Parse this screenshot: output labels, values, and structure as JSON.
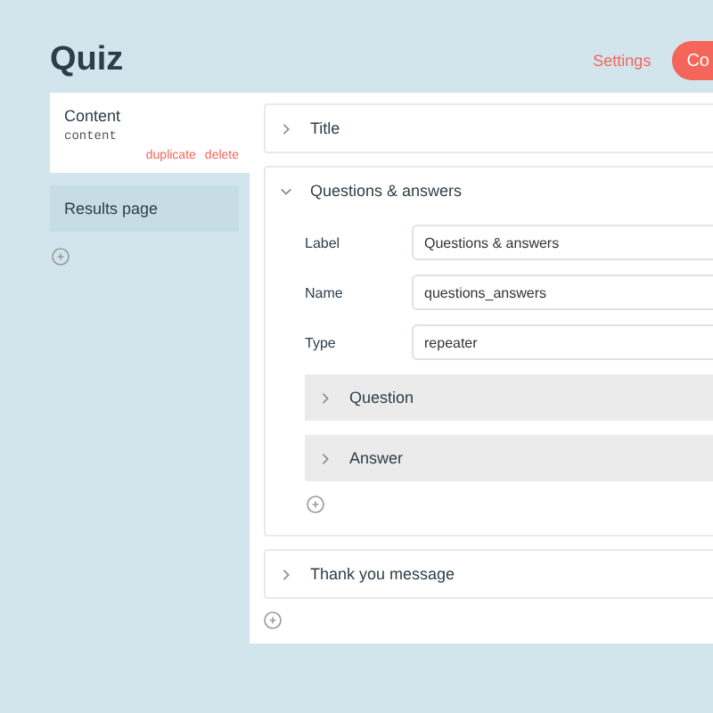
{
  "title": "Quiz",
  "header": {
    "settings_link": "Settings",
    "button": "Co"
  },
  "sidebar": {
    "items": [
      {
        "label": "Content",
        "name": "content",
        "selected": true,
        "actions": [
          "duplicate",
          "delete"
        ]
      },
      {
        "label": "Results page",
        "selected": false
      }
    ]
  },
  "sections": [
    {
      "title": "Title",
      "expanded": false
    },
    {
      "title": "Questions & answers",
      "expanded": true,
      "fields": [
        {
          "label": "Label",
          "value": "Questions & answers"
        },
        {
          "label": "Name",
          "value": "questions_answers"
        },
        {
          "label": "Type",
          "value": "repeater"
        }
      ],
      "rows": [
        {
          "title": "Question",
          "expanded": false
        },
        {
          "title": "Answer",
          "expanded": false
        }
      ]
    },
    {
      "title": "Thank you message",
      "expanded": false
    }
  ]
}
